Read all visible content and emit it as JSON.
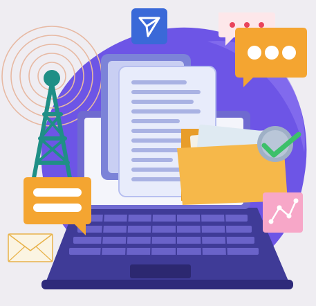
{
  "illustration": {
    "colors": {
      "background": "#efedf2",
      "blob": "#6d55e6",
      "blob_light": "#8f78f2",
      "laptop_body": "#3f3b97",
      "laptop_keys": "#6a63c9",
      "laptop_screen_frame": "#6f6ad0",
      "paper": "#e8ecfb",
      "paper_lines": "#a9b2e3",
      "folder": "#f6b84a",
      "folder_dark": "#e89d2a",
      "check_circle": "#9fb0c6",
      "check": "#3cc06a",
      "tower": "#1f8f86",
      "chat_orange": "#f4a531",
      "chat_pink": "#fde7ea",
      "dot_red": "#e9445c",
      "send_blue": "#3a69d8",
      "envelope": "#fbf4e2",
      "envelope_line": "#e8b24a",
      "chart_pink": "#f7a7c8",
      "rings": "#e7b9a3"
    },
    "icons": [
      "send-icon",
      "broadcast-tower-icon",
      "chat-bubble-icon",
      "folder-icon",
      "check-icon",
      "envelope-icon",
      "chart-icon",
      "document-icon",
      "laptop-icon"
    ]
  }
}
